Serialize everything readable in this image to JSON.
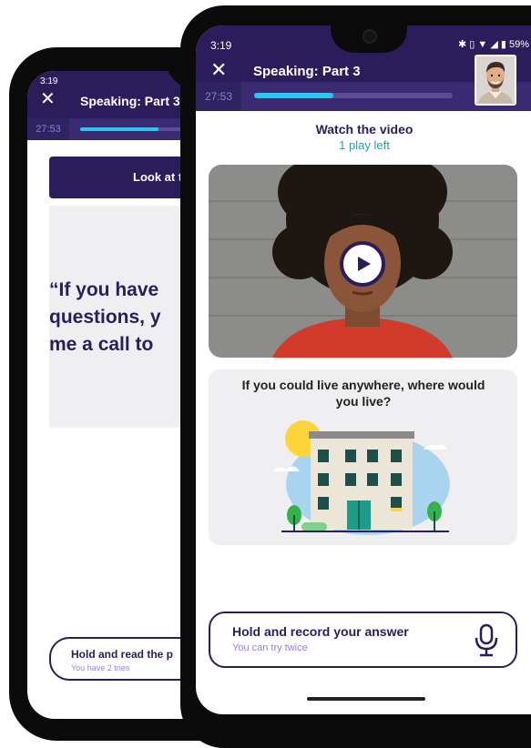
{
  "back_screen": {
    "status_time": "3:19",
    "title": "Speaking: Part 3",
    "timer": "27:53",
    "progress": 0.45,
    "look_button_label": "Look at t",
    "quote_lines": [
      "“If you have",
      "questions, y",
      "me a call to"
    ],
    "hold_title": "Hold and read the p",
    "hold_subtitle": "You have 2 tries"
  },
  "front_screen": {
    "status_time": "3:19",
    "status_icons": [
      "bluetooth-icon",
      "vibrate-icon",
      "wifi-icon",
      "signal-icon",
      "battery-icon"
    ],
    "battery": "59%",
    "title": "Speaking: Part 3",
    "timer": "27:53",
    "progress": 0.4,
    "watch_title": "Watch the video",
    "plays_left": "1 play left",
    "question": "If you could live anywhere, where would you live?",
    "record_title": "Hold and record your answer",
    "record_subtitle": "You can try twice"
  },
  "colors": {
    "primary": "#2b1d5c",
    "progress_fill": "#29c6ee",
    "accent_teal": "#1fa5a0",
    "accent_lilac": "#9b7fe0"
  }
}
